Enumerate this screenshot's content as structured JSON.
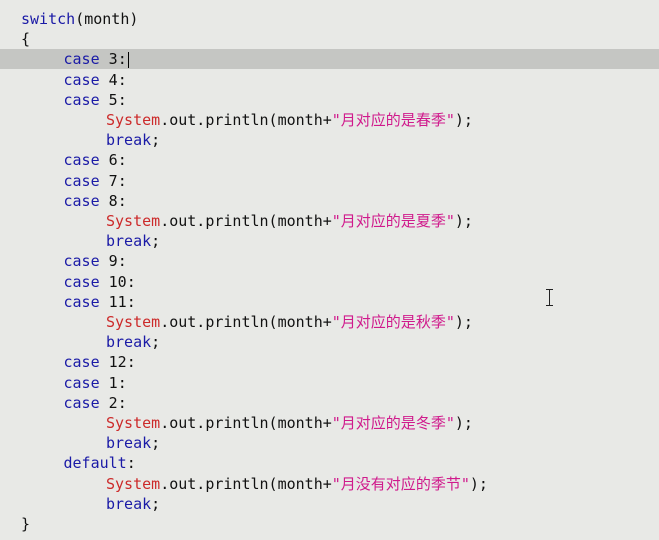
{
  "editor": {
    "current_line_index": 2,
    "lines": [
      {
        "indent": 0,
        "tokens": [
          {
            "t": "switch",
            "c": "kw"
          },
          {
            "t": "(month)",
            "c": "plain"
          }
        ]
      },
      {
        "indent": 0,
        "tokens": [
          {
            "t": "{",
            "c": "plain"
          }
        ]
      },
      {
        "indent": 1,
        "tokens": [
          {
            "t": "case ",
            "c": "kw"
          },
          {
            "t": "3",
            "c": "num"
          },
          {
            "t": ":",
            "c": "plain"
          }
        ]
      },
      {
        "indent": 1,
        "tokens": [
          {
            "t": "case ",
            "c": "kw"
          },
          {
            "t": "4",
            "c": "num"
          },
          {
            "t": ":",
            "c": "plain"
          }
        ]
      },
      {
        "indent": 1,
        "tokens": [
          {
            "t": "case ",
            "c": "kw"
          },
          {
            "t": "5",
            "c": "num"
          },
          {
            "t": ":",
            "c": "plain"
          }
        ]
      },
      {
        "indent": 2,
        "tokens": [
          {
            "t": "System",
            "c": "sys"
          },
          {
            "t": ".out.println(month+",
            "c": "plain"
          },
          {
            "t": "\"月对应的是春季\"",
            "c": "str"
          },
          {
            "t": ");",
            "c": "plain"
          }
        ]
      },
      {
        "indent": 2,
        "tokens": [
          {
            "t": "break",
            "c": "kw"
          },
          {
            "t": ";",
            "c": "plain"
          }
        ]
      },
      {
        "indent": 1,
        "tokens": [
          {
            "t": "case ",
            "c": "kw"
          },
          {
            "t": "6",
            "c": "num"
          },
          {
            "t": ":",
            "c": "plain"
          }
        ]
      },
      {
        "indent": 1,
        "tokens": [
          {
            "t": "case ",
            "c": "kw"
          },
          {
            "t": "7",
            "c": "num"
          },
          {
            "t": ":",
            "c": "plain"
          }
        ]
      },
      {
        "indent": 1,
        "tokens": [
          {
            "t": "case ",
            "c": "kw"
          },
          {
            "t": "8",
            "c": "num"
          },
          {
            "t": ":",
            "c": "plain"
          }
        ]
      },
      {
        "indent": 2,
        "tokens": [
          {
            "t": "System",
            "c": "sys"
          },
          {
            "t": ".out.println(month+",
            "c": "plain"
          },
          {
            "t": "\"月对应的是夏季\"",
            "c": "str"
          },
          {
            "t": ");",
            "c": "plain"
          }
        ]
      },
      {
        "indent": 2,
        "tokens": [
          {
            "t": "break",
            "c": "kw"
          },
          {
            "t": ";",
            "c": "plain"
          }
        ]
      },
      {
        "indent": 1,
        "tokens": [
          {
            "t": "case ",
            "c": "kw"
          },
          {
            "t": "9",
            "c": "num"
          },
          {
            "t": ":",
            "c": "plain"
          }
        ]
      },
      {
        "indent": 1,
        "tokens": [
          {
            "t": "case ",
            "c": "kw"
          },
          {
            "t": "10",
            "c": "num"
          },
          {
            "t": ":",
            "c": "plain"
          }
        ]
      },
      {
        "indent": 1,
        "tokens": [
          {
            "t": "case ",
            "c": "kw"
          },
          {
            "t": "11",
            "c": "num"
          },
          {
            "t": ":",
            "c": "plain"
          }
        ]
      },
      {
        "indent": 2,
        "tokens": [
          {
            "t": "System",
            "c": "sys"
          },
          {
            "t": ".out.println(month+",
            "c": "plain"
          },
          {
            "t": "\"月对应的是秋季\"",
            "c": "str"
          },
          {
            "t": ");",
            "c": "plain"
          }
        ]
      },
      {
        "indent": 2,
        "tokens": [
          {
            "t": "break",
            "c": "kw"
          },
          {
            "t": ";",
            "c": "plain"
          }
        ]
      },
      {
        "indent": 1,
        "tokens": [
          {
            "t": "case ",
            "c": "kw"
          },
          {
            "t": "12",
            "c": "num"
          },
          {
            "t": ":",
            "c": "plain"
          }
        ]
      },
      {
        "indent": 1,
        "tokens": [
          {
            "t": "case ",
            "c": "kw"
          },
          {
            "t": "1",
            "c": "num"
          },
          {
            "t": ":",
            "c": "plain"
          }
        ]
      },
      {
        "indent": 1,
        "tokens": [
          {
            "t": "case ",
            "c": "kw"
          },
          {
            "t": "2",
            "c": "num"
          },
          {
            "t": ":",
            "c": "plain"
          }
        ]
      },
      {
        "indent": 2,
        "tokens": [
          {
            "t": "System",
            "c": "sys"
          },
          {
            "t": ".out.println(month+",
            "c": "plain"
          },
          {
            "t": "\"月对应的是冬季\"",
            "c": "str"
          },
          {
            "t": ");",
            "c": "plain"
          }
        ]
      },
      {
        "indent": 2,
        "tokens": [
          {
            "t": "break",
            "c": "kw"
          },
          {
            "t": ";",
            "c": "plain"
          }
        ]
      },
      {
        "indent": 1,
        "tokens": [
          {
            "t": "default",
            "c": "kw"
          },
          {
            "t": ":",
            "c": "plain"
          }
        ]
      },
      {
        "indent": 2,
        "tokens": [
          {
            "t": "System",
            "c": "sys"
          },
          {
            "t": ".out.println(month+",
            "c": "plain"
          },
          {
            "t": "\"月没有对应的季节\"",
            "c": "str"
          },
          {
            "t": ");",
            "c": "plain"
          }
        ]
      },
      {
        "indent": 2,
        "tokens": [
          {
            "t": "break",
            "c": "kw"
          },
          {
            "t": ";",
            "c": "plain"
          }
        ]
      },
      {
        "indent": 0,
        "tokens": [
          {
            "t": "}",
            "c": "plain"
          }
        ]
      }
    ],
    "colors": {
      "background": "#e8e9e6",
      "current_line": "#c5c6c3",
      "keyword": "#1a1aa6",
      "class_name": "#cc2a2a",
      "string": "#d01a8c",
      "plain": "#111111"
    },
    "mouse_cursor": "i-beam-cursor"
  }
}
